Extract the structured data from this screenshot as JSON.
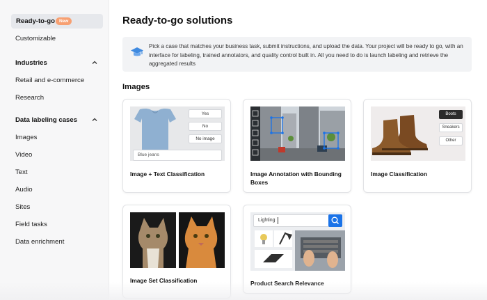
{
  "sidebar": {
    "active": {
      "label": "Ready-to-go",
      "badge": "New"
    },
    "items": [
      {
        "label": "Customizable"
      },
      {
        "label": "Industries"
      },
      {
        "label": "Retail and e-commerce"
      },
      {
        "label": "Research"
      },
      {
        "label": "Data labeling cases"
      },
      {
        "label": "Images"
      },
      {
        "label": "Video"
      },
      {
        "label": "Text"
      },
      {
        "label": "Audio"
      },
      {
        "label": "Sites"
      },
      {
        "label": "Field tasks"
      },
      {
        "label": "Data enrichment"
      }
    ]
  },
  "main": {
    "title": "Ready-to-go solutions",
    "info": "Pick a case that matches your business task, submit instructions, and upload the data. Your project will be ready to go, with an interface for labeling, trained annotators, and quality control built in. All you need to do is launch labeling and retrieve the aggregated results",
    "section": "Images",
    "cards": [
      {
        "label": "Image + Text Classification",
        "options": [
          "Yes",
          "No",
          "No image"
        ],
        "caption": "Blue jeans"
      },
      {
        "label": "Image Annotation with Bounding Boxes"
      },
      {
        "label": "Image Classification",
        "options": [
          "Boots",
          "Sneakers",
          "Other"
        ]
      },
      {
        "label": "Image Set Classification"
      },
      {
        "label": "Product Search Relevance",
        "search_text": "Lighting"
      }
    ]
  },
  "colors": {
    "accent": "#1a73e8",
    "badge": "#f7a072",
    "sidebar_bg": "#f7f7f8"
  }
}
